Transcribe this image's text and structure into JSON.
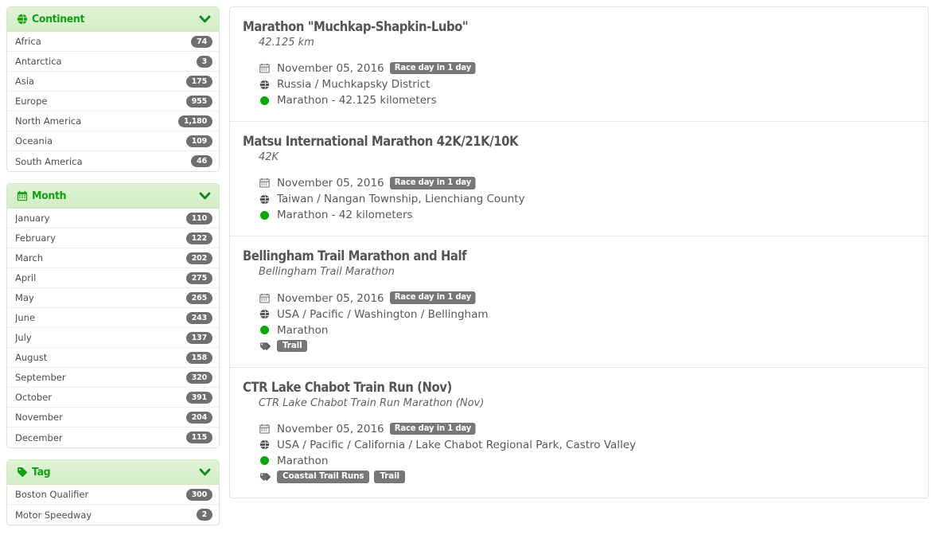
{
  "facets": [
    {
      "id": "continent",
      "title": "Continent",
      "icon": "globe-icon",
      "chevron": "chevron-down-icon",
      "items": [
        {
          "label": "Africa",
          "count": "74"
        },
        {
          "label": "Antarctica",
          "count": "3"
        },
        {
          "label": "Asia",
          "count": "175"
        },
        {
          "label": "Europe",
          "count": "955"
        },
        {
          "label": "North America",
          "count": "1,180"
        },
        {
          "label": "Oceania",
          "count": "109"
        },
        {
          "label": "South America",
          "count": "46"
        }
      ]
    },
    {
      "id": "month",
      "title": "Month",
      "icon": "calendar-icon",
      "chevron": "chevron-down-icon",
      "items": [
        {
          "label": "January",
          "count": "110"
        },
        {
          "label": "February",
          "count": "122"
        },
        {
          "label": "March",
          "count": "202"
        },
        {
          "label": "April",
          "count": "275"
        },
        {
          "label": "May",
          "count": "265"
        },
        {
          "label": "June",
          "count": "243"
        },
        {
          "label": "July",
          "count": "137"
        },
        {
          "label": "August",
          "count": "158"
        },
        {
          "label": "September",
          "count": "320"
        },
        {
          "label": "October",
          "count": "391"
        },
        {
          "label": "November",
          "count": "204"
        },
        {
          "label": "December",
          "count": "115"
        }
      ]
    },
    {
      "id": "tag",
      "title": "Tag",
      "icon": "tag-icon",
      "chevron": "chevron-down-icon",
      "items": [
        {
          "label": "Boston Qualifier",
          "count": "300"
        },
        {
          "label": "Motor Speedway",
          "count": "2"
        }
      ]
    }
  ],
  "races": [
    {
      "title": "Marathon \"Muchkap-Shapkin-Lubo\"",
      "subtitle": "42.125 km",
      "date": "November 05, 2016",
      "race_day_badge": "Race day in 1 day",
      "location": "Russia / Muchkapsky District",
      "distance": "Marathon - 42.125 kilometers",
      "tags": []
    },
    {
      "title": "Matsu International Marathon 42K/21K/10K",
      "subtitle": "42K",
      "date": "November 05, 2016",
      "race_day_badge": "Race day in 1 day",
      "location": "Taiwan / Nangan Township, Lienchiang County",
      "distance": "Marathon - 42 kilometers",
      "tags": []
    },
    {
      "title": "Bellingham Trail Marathon and Half",
      "subtitle": "Bellingham Trail Marathon",
      "date": "November 05, 2016",
      "race_day_badge": "Race day in 1 day",
      "location": "USA / Pacific / Washington / Bellingham",
      "distance": "Marathon",
      "tags": [
        "Trail"
      ]
    },
    {
      "title": "CTR Lake Chabot Train Run (Nov)",
      "subtitle": "CTR Lake Chabot Train Run Marathon (Nov)",
      "date": "November 05, 2016",
      "race_day_badge": "Race day in 1 day",
      "location": "USA / Pacific / California / Lake Chabot Regional Park, Castro Valley",
      "distance": "Marathon",
      "tags": [
        "Coastal Trail Runs",
        "Trail"
      ]
    }
  ],
  "colors": {
    "facet_header_green": "#14a014",
    "facet_header_bg": "#d9f0ce",
    "badge_gray": "#6f6f6f",
    "chip_gray": "#777777",
    "distance_dot_green": "#0aa80a",
    "title_gray": "#555555"
  }
}
